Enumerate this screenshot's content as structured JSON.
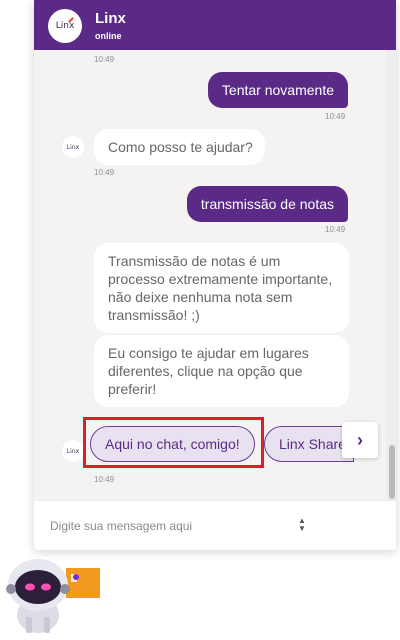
{
  "header": {
    "title": "Linx",
    "status": "online",
    "logo_text": "Linx"
  },
  "colors": {
    "brand": "#5b2a86",
    "highlight": "#d7202a",
    "chat_bg": "#f5f3f1"
  },
  "messages": [
    {
      "kind": "time",
      "text": "10:49"
    },
    {
      "kind": "user",
      "text": "Tentar novamente",
      "time": "10:49"
    },
    {
      "kind": "bot",
      "text": "Como posso te ajudar?",
      "time": "10:49"
    },
    {
      "kind": "user",
      "text": "transmissão de notas",
      "time": "10:49"
    },
    {
      "kind": "bot",
      "text": "Transmissão de notas é um processo extremamente importante, não deixe nenhuma nota sem transmissão! ;)"
    },
    {
      "kind": "bot",
      "text": "Eu consigo te ajudar em lugares diferentes, clique na opção que preferir!"
    }
  ],
  "options": [
    {
      "label": "Aqui no chat, comigo!"
    },
    {
      "label": "Linx Share"
    }
  ],
  "options_time": "10:49",
  "next_icon": "chevron-right-icon",
  "input": {
    "placeholder": "Digite sua mensagem aqui",
    "value": ""
  }
}
